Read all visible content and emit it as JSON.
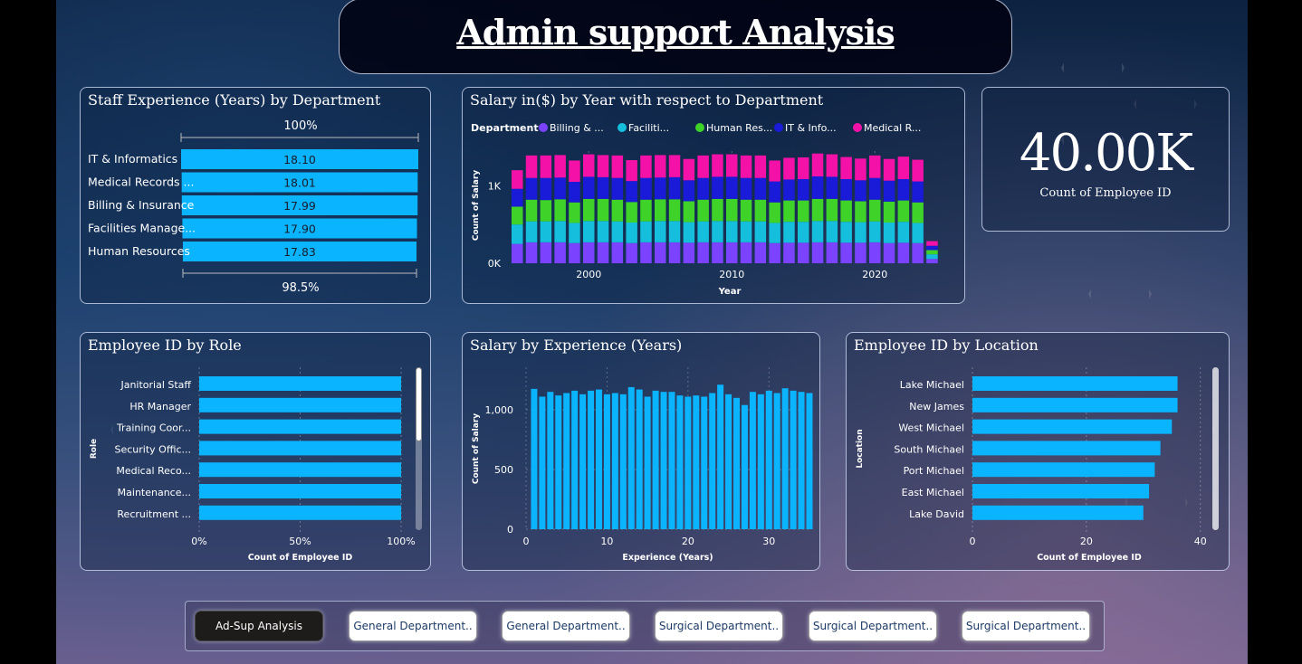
{
  "header": {
    "title": "Admin support Analysis"
  },
  "colors": {
    "bar": "#0ab4ff",
    "billing": "#7b43ff",
    "facilities": "#15bedc",
    "hr": "#3fd32a",
    "it": "#1a1bd8",
    "medical": "#f311a8"
  },
  "experience_panel": {
    "title": "Staff Experience (Years) by Department",
    "top_label": "100%",
    "bottom_label": "98.5%",
    "rows": [
      {
        "label": "IT & Informatics",
        "value": "18.10",
        "num": 18.1
      },
      {
        "label": "Medical Records ...",
        "value": "18.01",
        "num": 18.01
      },
      {
        "label": "Billing & Insurance",
        "value": "17.99",
        "num": 17.99
      },
      {
        "label": "Facilities Manage...",
        "value": "17.90",
        "num": 17.9
      },
      {
        "label": "Human Resources",
        "value": "17.83",
        "num": 17.83
      }
    ]
  },
  "kpi": {
    "value": "40.00K",
    "label": "Count of Employee ID"
  },
  "nav": {
    "buttons": [
      "Ad-Sup Analysis",
      "General Department..",
      "General Department..",
      "Surgical Department..",
      "Surgical Department..",
      "Surgical Department.."
    ]
  },
  "chart_data": [
    {
      "type": "bar",
      "stacked": true,
      "title": "Salary in($) by Year with respect to Department",
      "xlabel": "Year",
      "ylabel": "Count of Salary",
      "legend_title": "Department",
      "legend_labels": [
        "Billing & ...",
        "Faciliti...",
        "Human Res...",
        "IT & Info...",
        "Medical R..."
      ],
      "legend_position": "top",
      "x_ticks": [
        "2000",
        "2010",
        "2020"
      ],
      "y_ticks": [
        "0K",
        "1K"
      ],
      "ylim": [
        0,
        1400
      ],
      "x": [
        1995,
        1996,
        1997,
        1998,
        1999,
        2000,
        2001,
        2002,
        2003,
        2004,
        2005,
        2006,
        2007,
        2008,
        2009,
        2010,
        2011,
        2012,
        2013,
        2014,
        2015,
        2016,
        2017,
        2018,
        2019,
        2020,
        2021,
        2022,
        2023,
        2024
      ],
      "series": [
        {
          "name": "Billing & ...",
          "values": [
            250,
            270,
            270,
            270,
            260,
            270,
            270,
            270,
            260,
            270,
            270,
            270,
            265,
            270,
            270,
            270,
            270,
            270,
            260,
            265,
            265,
            270,
            270,
            265,
            265,
            270,
            260,
            265,
            260,
            55
          ]
        },
        {
          "name": "Faciliti...",
          "values": [
            250,
            270,
            270,
            275,
            260,
            275,
            275,
            270,
            265,
            270,
            275,
            275,
            265,
            270,
            275,
            275,
            270,
            270,
            260,
            270,
            270,
            275,
            275,
            270,
            265,
            270,
            265,
            270,
            260,
            60
          ]
        },
        {
          "name": "Human Res...",
          "values": [
            230,
            280,
            275,
            280,
            265,
            285,
            285,
            280,
            265,
            280,
            280,
            280,
            270,
            280,
            285,
            285,
            280,
            280,
            265,
            275,
            275,
            285,
            285,
            275,
            270,
            280,
            270,
            275,
            265,
            55
          ]
        },
        {
          "name": "IT & Info...",
          "values": [
            230,
            280,
            285,
            280,
            265,
            285,
            280,
            280,
            270,
            280,
            280,
            285,
            270,
            280,
            285,
            285,
            280,
            280,
            270,
            270,
            275,
            290,
            285,
            275,
            270,
            280,
            270,
            275,
            270,
            55
          ]
        },
        {
          "name": "Medical R...",
          "values": [
            240,
            290,
            290,
            290,
            275,
            290,
            285,
            290,
            270,
            290,
            290,
            285,
            275,
            290,
            290,
            290,
            290,
            290,
            270,
            280,
            280,
            295,
            290,
            285,
            280,
            290,
            280,
            290,
            280,
            60
          ]
        }
      ]
    },
    {
      "type": "bar",
      "orientation": "horizontal",
      "title": "Employee ID by Role",
      "xlabel": "Count of Employee ID",
      "ylabel": "Role",
      "x_ticks": [
        "0%",
        "50%",
        "100%"
      ],
      "categories": [
        "Janitorial Staff",
        "HR Manager",
        "Training Coor...",
        "Security Offic...",
        "Medical Reco...",
        "Maintenance...",
        "Recruitment ..."
      ],
      "values": [
        100,
        100,
        100,
        100,
        100,
        100,
        100
      ],
      "xlim": [
        0,
        100
      ]
    },
    {
      "type": "bar",
      "title": "Salary by Experience (Years)",
      "xlabel": "Experience (Years)",
      "ylabel": "Count of Salary",
      "x_ticks": [
        "0",
        "10",
        "20",
        "30"
      ],
      "y_ticks": [
        "0",
        "500",
        "1,000"
      ],
      "ylim": [
        0,
        1250
      ],
      "xlim": [
        0,
        35
      ],
      "x": [
        1,
        2,
        3,
        4,
        5,
        6,
        7,
        8,
        9,
        10,
        11,
        12,
        13,
        14,
        15,
        16,
        17,
        18,
        19,
        20,
        21,
        22,
        23,
        24,
        25,
        26,
        27,
        28,
        29,
        30,
        31,
        32,
        33,
        34,
        35
      ],
      "values": [
        1175,
        1110,
        1150,
        1120,
        1140,
        1160,
        1130,
        1160,
        1170,
        1130,
        1140,
        1130,
        1190,
        1170,
        1110,
        1160,
        1150,
        1150,
        1120,
        1110,
        1120,
        1110,
        1140,
        1210,
        1130,
        1100,
        1040,
        1150,
        1130,
        1160,
        1140,
        1180,
        1160,
        1150,
        1140
      ]
    },
    {
      "type": "bar",
      "orientation": "horizontal",
      "title": "Employee ID by Location",
      "xlabel": "Count of Employee ID",
      "ylabel": "Location",
      "x_ticks": [
        "0",
        "20",
        "40"
      ],
      "categories": [
        "Lake Michael",
        "New James",
        "West Michael",
        "South Michael",
        "Port Michael",
        "East Michael",
        "Lake David"
      ],
      "values": [
        36,
        36,
        35,
        33,
        32,
        31,
        30
      ],
      "xlim": [
        0,
        41
      ]
    }
  ]
}
